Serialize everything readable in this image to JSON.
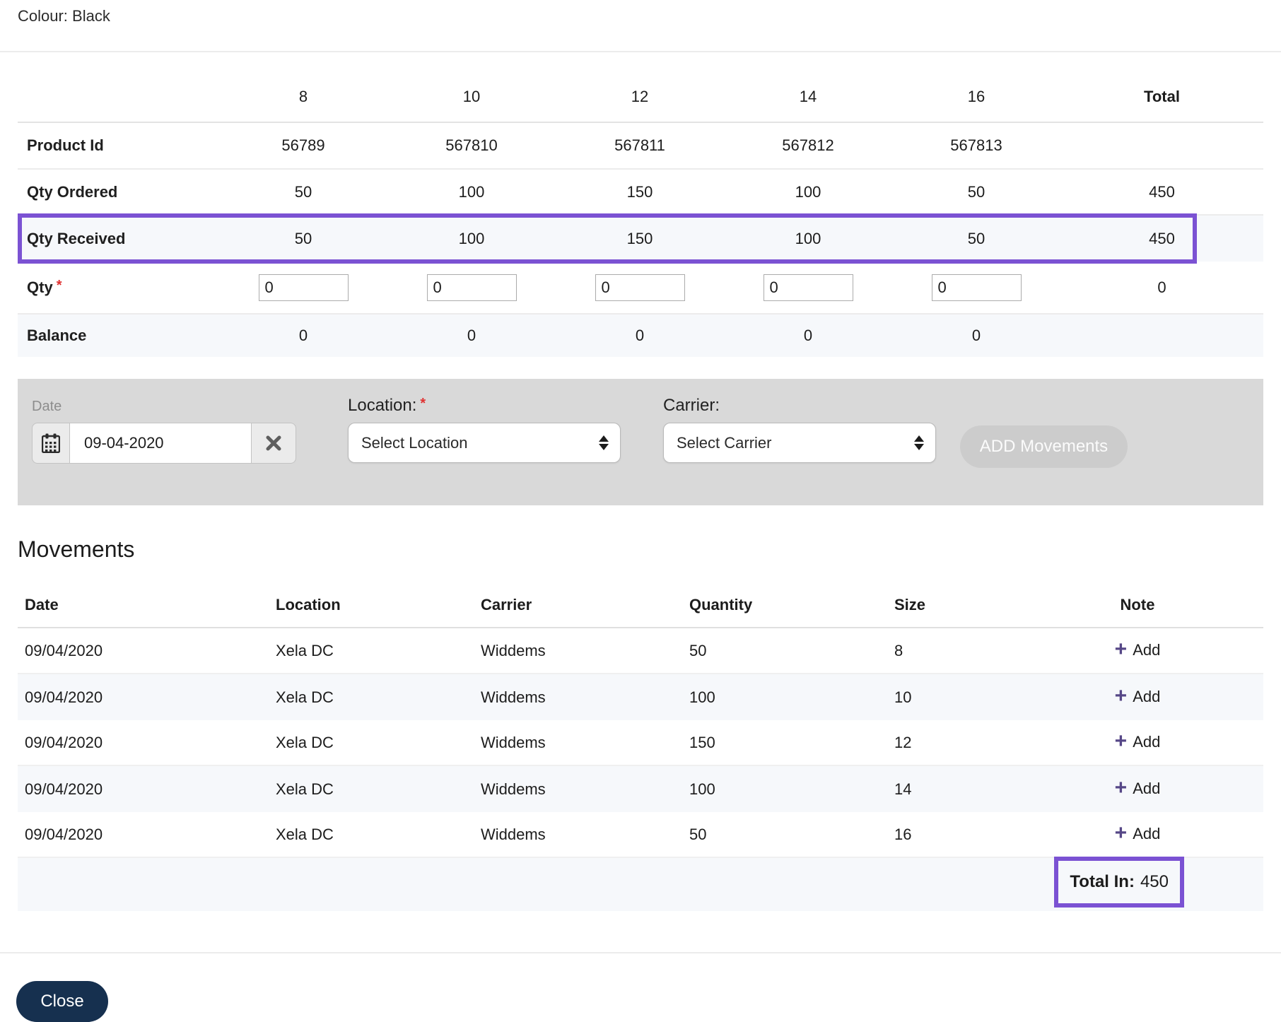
{
  "header": {
    "colour_label": "Colour: Black"
  },
  "size_table": {
    "size_headers": [
      "8",
      "10",
      "12",
      "14",
      "16"
    ],
    "total_header": "Total",
    "rows": {
      "product_id": {
        "label": "Product Id",
        "values": [
          "56789",
          "567810",
          "567811",
          "567812",
          "567813"
        ],
        "total": ""
      },
      "qty_ordered": {
        "label": "Qty Ordered",
        "values": [
          "50",
          "100",
          "150",
          "100",
          "50"
        ],
        "total": "450"
      },
      "qty_received": {
        "label": "Qty Received",
        "values": [
          "50",
          "100",
          "150",
          "100",
          "50"
        ],
        "total": "450"
      },
      "qty": {
        "label": "Qty",
        "required_mark": "*",
        "input_values": [
          "0",
          "0",
          "0",
          "0",
          "0"
        ],
        "total": "0"
      },
      "balance": {
        "label": "Balance",
        "values": [
          "0",
          "0",
          "0",
          "0",
          "0"
        ],
        "total": ""
      }
    }
  },
  "movement_form": {
    "date_label": "Date",
    "date_value": "09-04-2020",
    "location_label": "Location:",
    "location_required_mark": "*",
    "location_selected": "Select Location",
    "carrier_label": "Carrier:",
    "carrier_selected": "Select Carrier",
    "add_button_label": "ADD Movements"
  },
  "movements": {
    "title": "Movements",
    "columns": [
      "Date",
      "Location",
      "Carrier",
      "Quantity",
      "Size",
      "Note"
    ],
    "rows": [
      {
        "date": "09/04/2020",
        "location": "Xela DC",
        "carrier": "Widdems",
        "quantity": "50",
        "size": "8",
        "note_action": "Add"
      },
      {
        "date": "09/04/2020",
        "location": "Xela DC",
        "carrier": "Widdems",
        "quantity": "100",
        "size": "10",
        "note_action": "Add"
      },
      {
        "date": "09/04/2020",
        "location": "Xela DC",
        "carrier": "Widdems",
        "quantity": "150",
        "size": "12",
        "note_action": "Add"
      },
      {
        "date": "09/04/2020",
        "location": "Xela DC",
        "carrier": "Widdems",
        "quantity": "100",
        "size": "14",
        "note_action": "Add"
      },
      {
        "date": "09/04/2020",
        "location": "Xela DC",
        "carrier": "Widdems",
        "quantity": "50",
        "size": "16",
        "note_action": "Add"
      }
    ],
    "total_in_label": "Total In:",
    "total_in_value": "450"
  },
  "footer": {
    "close_label": "Close"
  },
  "colors": {
    "annotation_purple": "#7b52d3",
    "plus_icon_purple": "#564787",
    "close_button_navy": "#16304f",
    "required_red": "#e03131",
    "panel_gray": "#d9d9d9",
    "shaded_row": "#f6f8fb"
  }
}
